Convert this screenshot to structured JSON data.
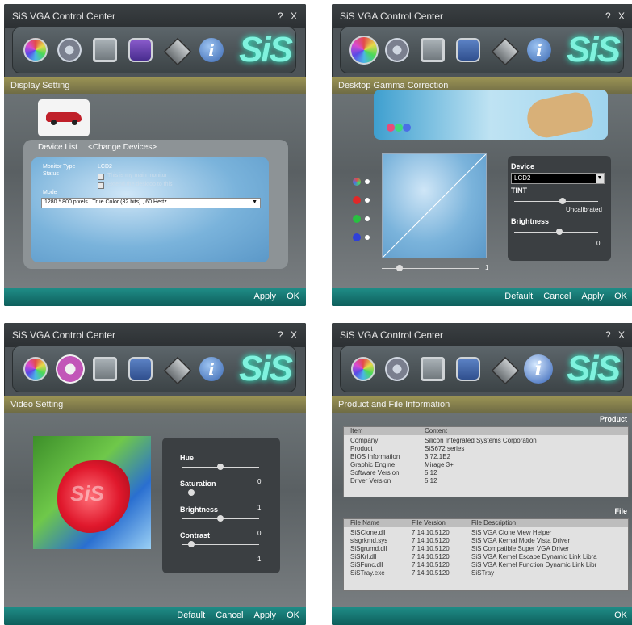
{
  "app": {
    "title": "SiS VGA Control Center",
    "title_buttons": "? X",
    "logo": "SiS"
  },
  "icons": [
    "color-wheel",
    "film-reel",
    "monitor",
    "gear",
    "diamond",
    "info"
  ],
  "windows": {
    "display": {
      "section": "Display Setting",
      "device_list": "Device List",
      "change_devices": "<Change Devices>",
      "monitor_type_label": "Monitor Type",
      "monitor_type_value": "LCD2",
      "status_label": "Status",
      "main_monitor": "This is my main monitor",
      "extend_desktop": "Extend the desktop to this",
      "mode_label": "Mode",
      "mode_value": "1280 * 800 pixels , True Color (32 bits) , 60 Hertz",
      "buttons": {
        "apply": "Apply",
        "ok": "OK"
      }
    },
    "gamma": {
      "section": "Desktop Gamma Correction",
      "device_label": "Device",
      "device_value": "LCD2",
      "tint_label": "TINT",
      "uncalibrated": "Uncalibrated",
      "brightness_label": "Brightness",
      "brightness_value": "0",
      "gamma_value": "1",
      "buttons": {
        "default": "Default",
        "cancel": "Cancel",
        "apply": "Apply",
        "ok": "OK"
      }
    },
    "video": {
      "section": "Video Setting",
      "hue_label": "Hue",
      "saturation_label": "Saturation",
      "saturation_value": "0",
      "brightness_label": "Brightness",
      "brightness_value": "1",
      "contrast_label": "Contrast",
      "contrast_value": "0",
      "last_value": "1",
      "buttons": {
        "default": "Default",
        "cancel": "Cancel",
        "apply": "Apply",
        "ok": "OK"
      }
    },
    "product": {
      "section": "Product and File Information",
      "product_header": "Product",
      "file_header": "File",
      "info_table": {
        "headers": [
          "Item",
          "Content"
        ],
        "rows": [
          [
            "Company",
            "Silicon Integrated Systems Corporation"
          ],
          [
            "Product",
            "SiS672 series"
          ],
          [
            "BIOS Information",
            "3.72.1E2"
          ],
          [
            "Graphic Engine",
            "Mirage 3+"
          ],
          [
            "Software Version",
            "5.12"
          ],
          [
            "Driver Version",
            "5.12"
          ]
        ]
      },
      "file_table": {
        "headers": [
          "File Name",
          "File Version",
          "File Description"
        ],
        "rows": [
          [
            "SiSClone.dll",
            "7.14.10.5120",
            "SiS VGA Clone View Helper"
          ],
          [
            "sisgrkmd.sys",
            "7.14.10.5120",
            "SiS VGA Kernal Mode Vista Driver"
          ],
          [
            "SiSgrumd.dll",
            "7.14.10.5120",
            "SiS Compatible Super VGA Driver"
          ],
          [
            "SiSKrl.dll",
            "7.14.10.5120",
            "SiS VGA Kernel Escape Dynamic Link Libra"
          ],
          [
            "SiSFunc.dll",
            "7.14.10.5120",
            "SiS VGA Kernel Function Dynamic Link Libr"
          ],
          [
            "SiSTray.exe",
            "7.14.10.5120",
            "SiSTray"
          ]
        ]
      },
      "buttons": {
        "ok": "OK"
      }
    }
  }
}
